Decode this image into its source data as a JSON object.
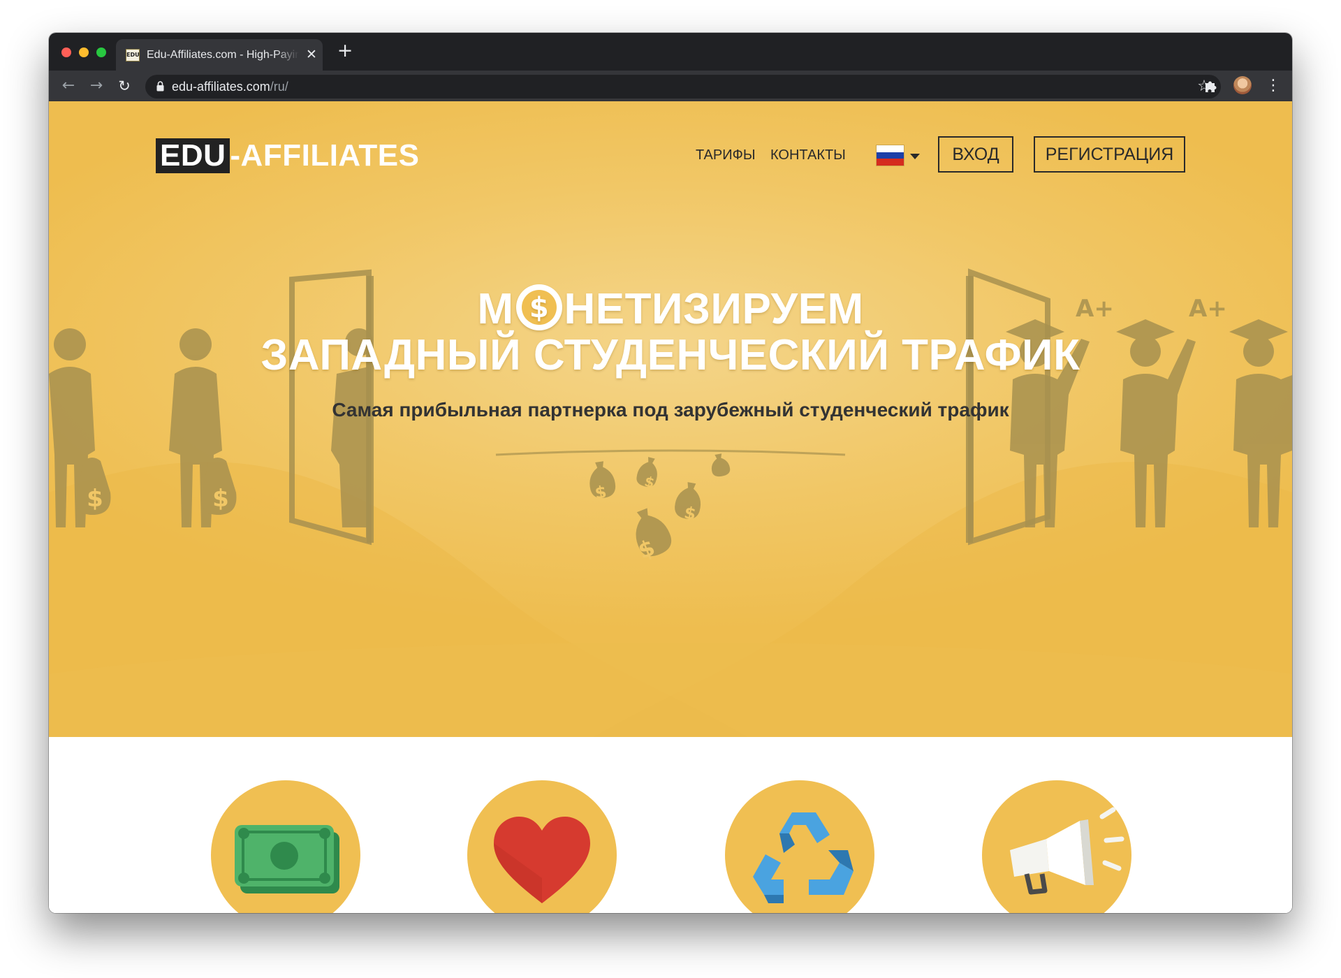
{
  "browser": {
    "tab_title": "Edu-Affiliates.com - High-Paying",
    "tab_favicon_text": "EDU",
    "tab_close": "✕",
    "new_tab": "+",
    "url_host": "edu-affiliates.com",
    "url_path": "/ru/",
    "back": "←",
    "forward": "→",
    "reload": "↻",
    "star": "☆",
    "menu": "⋮"
  },
  "header": {
    "logo_box": "EDU",
    "logo_rest": "-AFFILIATES",
    "nav": {
      "tariffs": "ТАРИФЫ",
      "contacts": "КОНТАКТЫ"
    },
    "language": "ru",
    "login_label": "ВХОД",
    "register_label": "РЕГИСТРАЦИЯ"
  },
  "hero": {
    "title_line1_a": "М",
    "title_line1_b": "НЕТИЗИРУЕМ",
    "title_line2": "ЗАПАДНЫЙ СТУДЕНЧЕСКИЙ ТРАФИК",
    "subtitle": "Самая прибыльная партнерка под зарубежный студенческий трафик",
    "grade_labels": [
      "A+",
      "A+"
    ]
  },
  "features": {
    "icons": [
      "money-icon",
      "heart-icon",
      "recycle-icon",
      "megaphone-icon"
    ]
  },
  "colors": {
    "hero_bg": "#f1c766",
    "feature_circle": "#f0bf52",
    "text_dark": "#2a2a2a",
    "browser_dark": "#202124"
  }
}
